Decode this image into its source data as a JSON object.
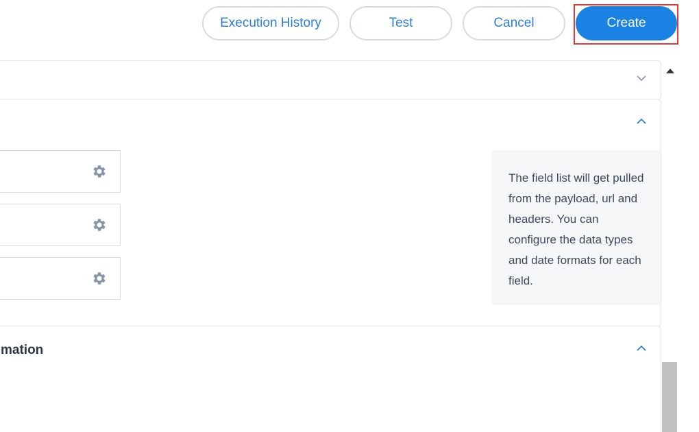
{
  "toolbar": {
    "execution_history_label": "Execution History",
    "test_label": "Test",
    "cancel_label": "Cancel",
    "create_label": "Create"
  },
  "panels": {
    "panel1": {
      "expanded": false
    },
    "panel2": {
      "expanded": true,
      "fields": [
        {
          "value": "",
          "icon": "gear-icon"
        },
        {
          "value": "",
          "icon": "gear-icon"
        },
        {
          "value": "",
          "icon": "gear-icon"
        }
      ],
      "info_text": "The field list will get pulled from the payload, url and headers. You can configure the data types and date formats for each field."
    },
    "panel3": {
      "expanded": true,
      "title_fragment": "mation"
    }
  },
  "colors": {
    "primary": "#1a82e2",
    "highlight": "#e03a3a",
    "border": "#d3dbe3",
    "info_bg": "#f4f6f8"
  }
}
